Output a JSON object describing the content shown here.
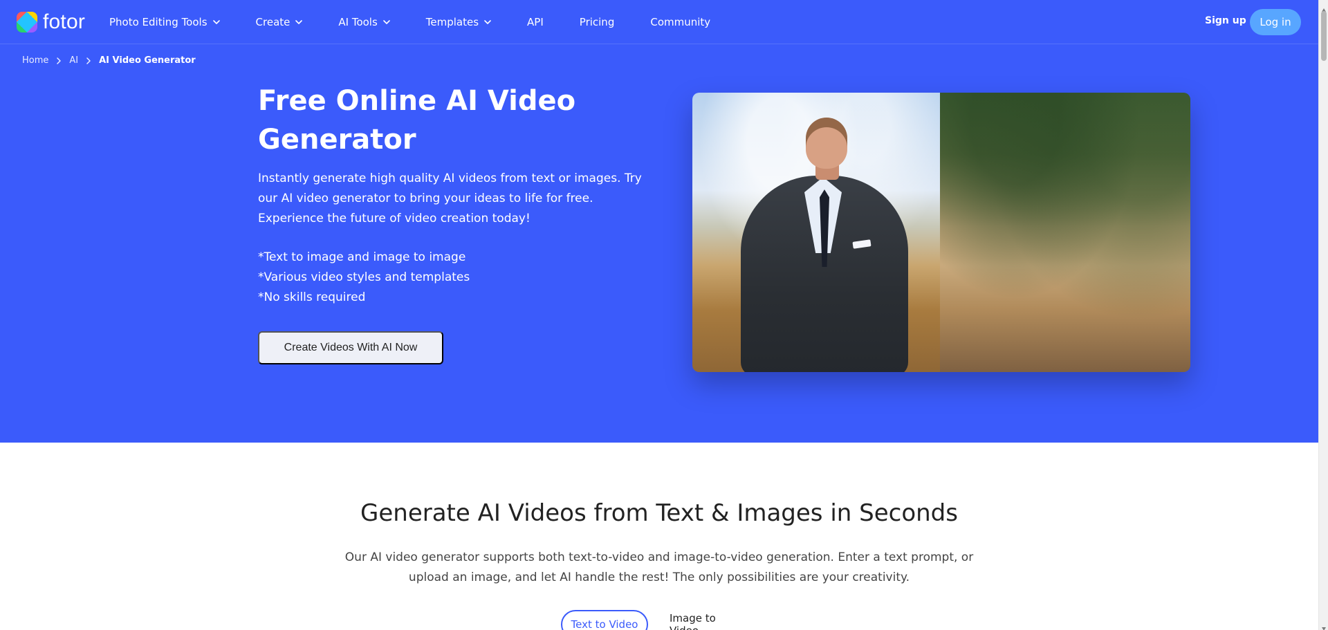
{
  "brand": {
    "name": "fotor"
  },
  "nav": {
    "items": [
      {
        "label": "Photo Editing Tools",
        "dropdown": true
      },
      {
        "label": "Create",
        "dropdown": true
      },
      {
        "label": "AI Tools",
        "dropdown": true
      },
      {
        "label": "Templates",
        "dropdown": true
      },
      {
        "label": "API",
        "dropdown": false
      },
      {
        "label": "Pricing",
        "dropdown": false
      },
      {
        "label": "Community",
        "dropdown": false
      }
    ],
    "sign_up": "Sign up",
    "log_in": "Log in"
  },
  "breadcrumb": {
    "items": [
      "Home",
      "AI",
      "AI Video Generator"
    ]
  },
  "hero": {
    "title_line1": "Free Online AI Video",
    "title_line2": "Generator",
    "description": "Instantly generate high quality AI videos from text or images. Try our AI video generator to bring your ideas to life for free. Experience the future of video creation today!",
    "bullets": [
      "*Text to image and image to image",
      "*Various video styles and templates",
      "*No skills required"
    ],
    "cta": "Create Videos With AI Now"
  },
  "section": {
    "title": "Generate AI Videos from Text & Images in Seconds",
    "description": "Our AI video generator supports both text-to-video and image-to-video generation. Enter a text prompt, or upload an image, and let AI handle the rest! The only possibilities are your creativity.",
    "tabs": [
      "Text to Video",
      "Image to Video"
    ]
  },
  "colors": {
    "hero_blue": "#3b5bfb",
    "login_blue": "#58a6ff",
    "cta_bg": "#eef0f7",
    "tab_active": "#3b5bfb"
  },
  "icons": {
    "chevron_down": "chevron-down-icon",
    "breadcrumb_sep": "chevron-right-icon",
    "scroll_up": "triangle-up-icon",
    "scroll_down": "triangle-down-icon"
  }
}
